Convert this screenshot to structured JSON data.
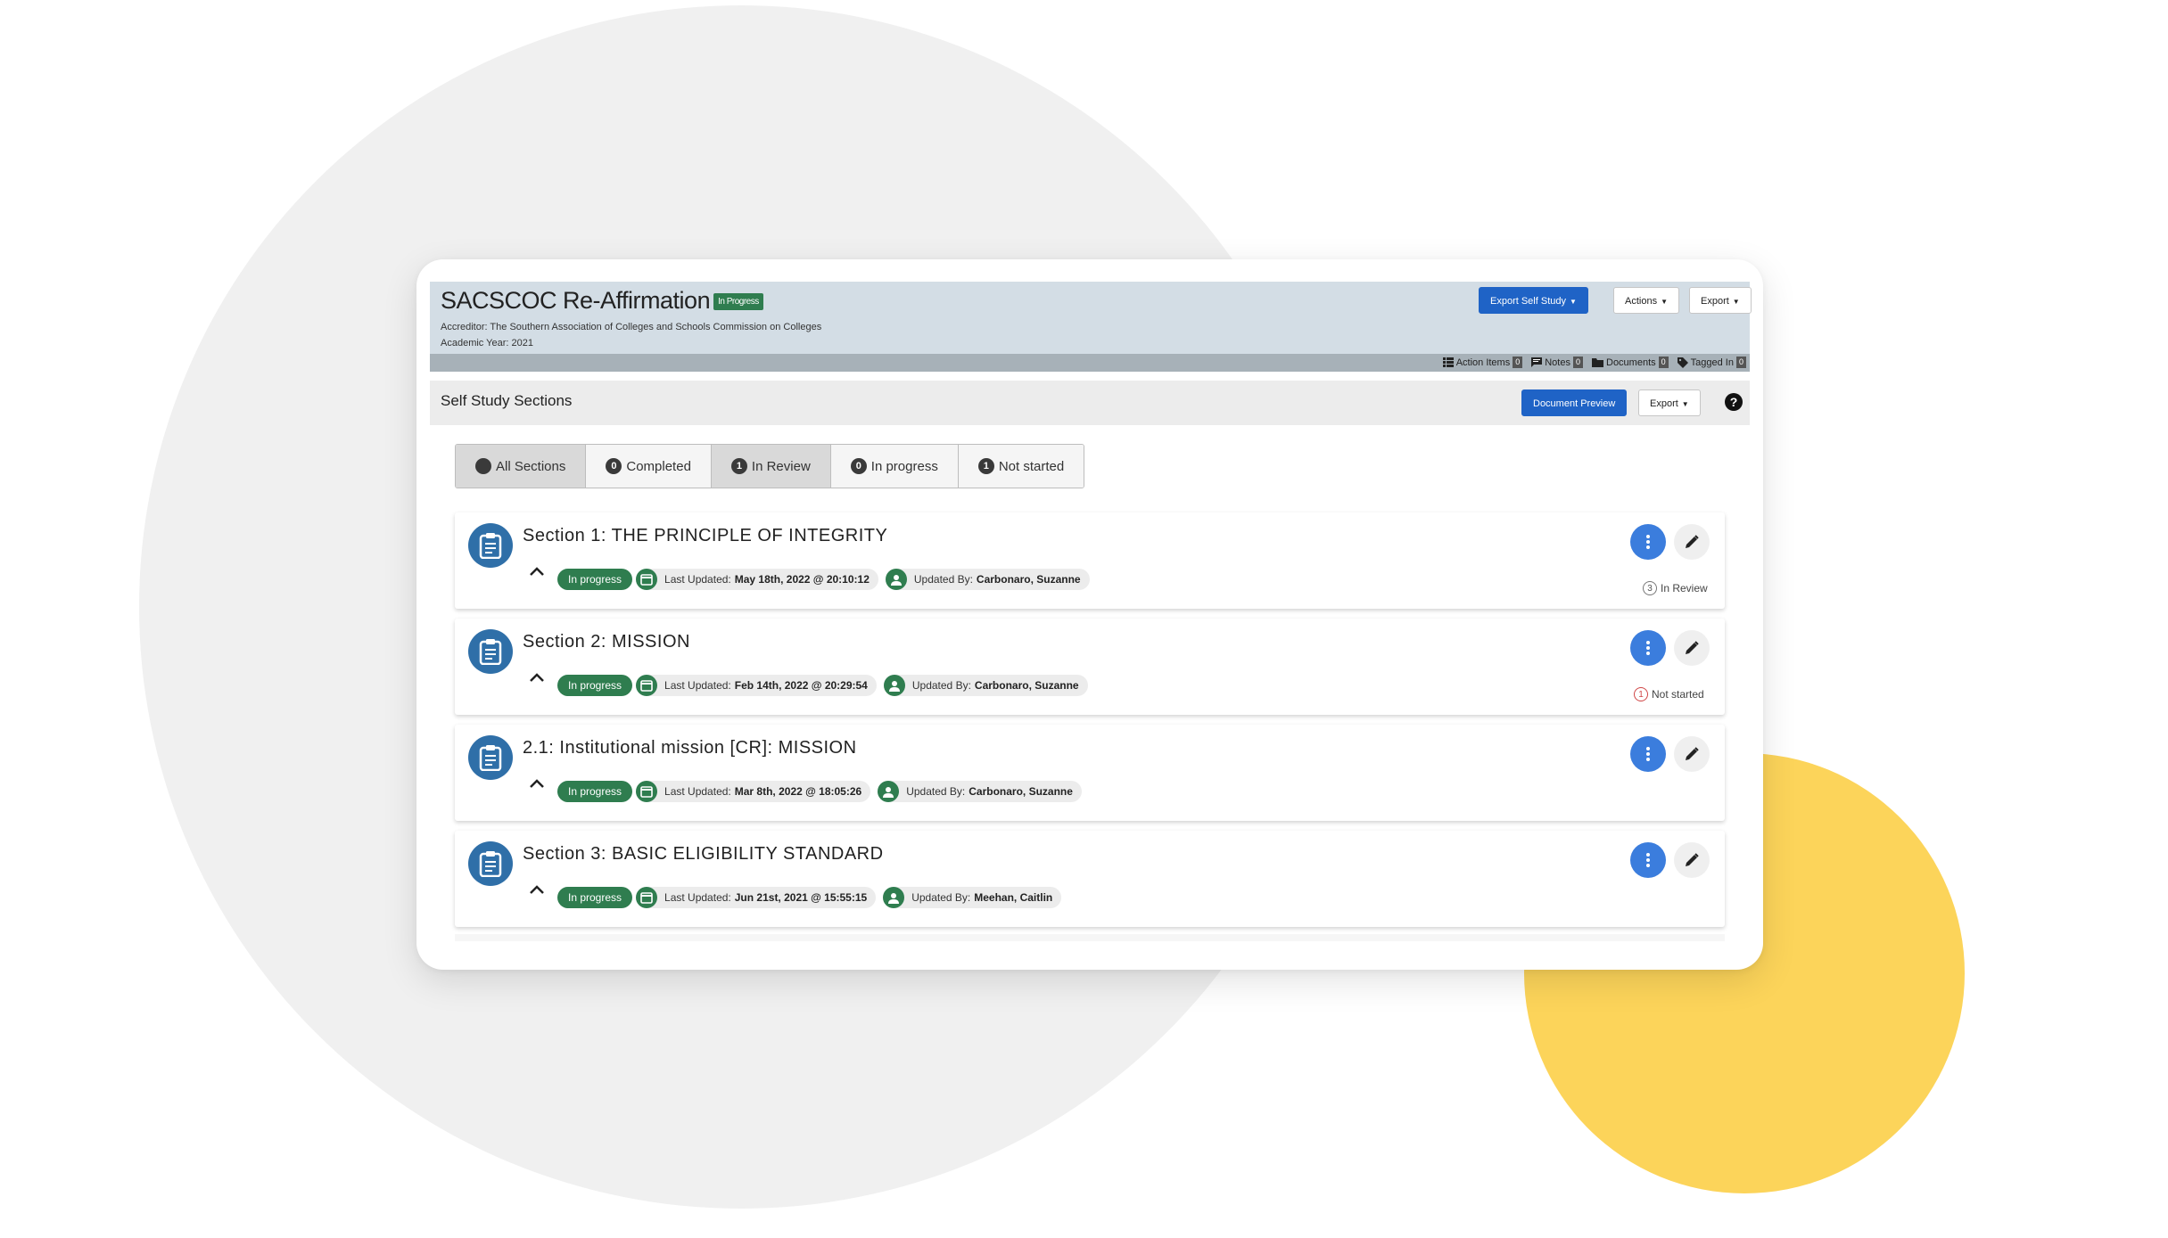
{
  "header": {
    "title": "SACSCOC Re-Affirmation",
    "status_badge": "In Progress",
    "accreditor": "Accreditor: The Southern Association of Colleges and Schools Commission on Colleges",
    "academic_year": "Academic Year: 2021",
    "buttons": {
      "export_self_study": "Export Self Study",
      "actions": "Actions",
      "export": "Export"
    },
    "counts": [
      {
        "icon": "list-icon",
        "label": "Action Items",
        "count": "0"
      },
      {
        "icon": "note-icon",
        "label": "Notes",
        "count": "0"
      },
      {
        "icon": "folder-icon",
        "label": "Documents",
        "count": "0"
      },
      {
        "icon": "tag-icon",
        "label": "Tagged In",
        "count": "0"
      }
    ]
  },
  "section_bar": {
    "title": "Self Study Sections",
    "document_preview": "Document Preview",
    "export": "Export",
    "help": "?"
  },
  "filters": [
    {
      "label": "All Sections",
      "count": "",
      "active": true
    },
    {
      "label": "Completed",
      "count": "0",
      "active": false
    },
    {
      "label": "In Review",
      "count": "1",
      "active": true
    },
    {
      "label": "In progress",
      "count": "0",
      "active": false
    },
    {
      "label": "Not started",
      "count": "1",
      "active": false
    }
  ],
  "sections": [
    {
      "title": "Section 1: THE PRINCIPLE OF INTEGRITY",
      "status": "In progress",
      "last_updated_label": "Last Updated:",
      "last_updated": "May 18th, 2022 @ 20:10:12",
      "updated_by_label": "Updated By:",
      "updated_by": "Carbonaro, Suzanne",
      "review_count": "3",
      "review_label": "In Review"
    },
    {
      "title": "Section 2: MISSION",
      "status": "In progress",
      "last_updated_label": "Last Updated:",
      "last_updated": "Feb 14th, 2022 @ 20:29:54",
      "updated_by_label": "Updated By:",
      "updated_by": "Carbonaro, Suzanne",
      "review_count": "1",
      "review_label": "Not started"
    },
    {
      "title": "2.1: Institutional mission [CR]: MISSION",
      "status": "In progress",
      "last_updated_label": "Last Updated:",
      "last_updated": "Mar 8th, 2022 @ 18:05:26",
      "updated_by_label": "Updated By:",
      "updated_by": "Carbonaro, Suzanne"
    },
    {
      "title": "Section 3: BASIC ELIGIBILITY STANDARD",
      "status": "In progress",
      "last_updated_label": "Last Updated:",
      "last_updated": "Jun 21st, 2021 @ 15:55:15",
      "updated_by_label": "Updated By:",
      "updated_by": "Meehan, Caitlin"
    }
  ],
  "colors": {
    "primary": "#1f63c6",
    "success": "#2f7d4f",
    "accent_yellow": "#fcd45a",
    "kebab_blue": "#3b7ddd"
  }
}
